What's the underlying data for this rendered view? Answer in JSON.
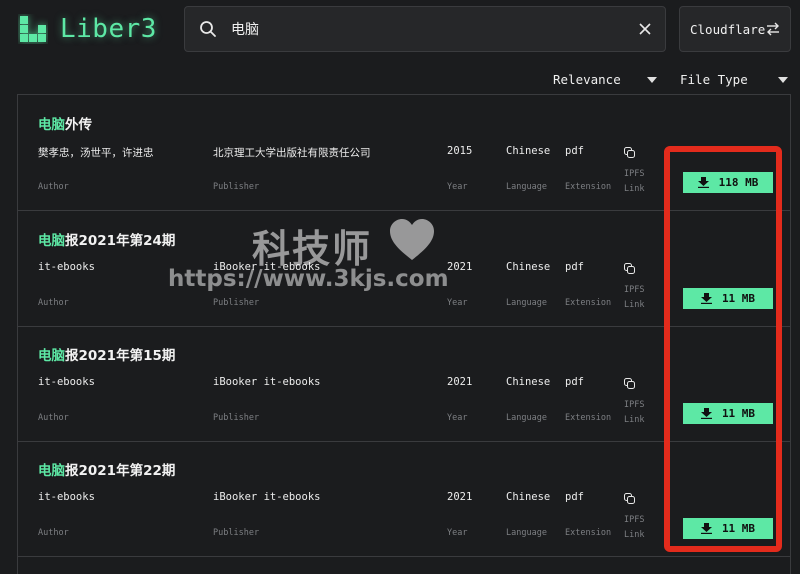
{
  "app": {
    "name": "Liber3"
  },
  "search": {
    "value": "电脑",
    "placeholder": ""
  },
  "gateway": {
    "label": "Cloudflare"
  },
  "sort": {
    "relevance": "Relevance",
    "file_type": "File Type"
  },
  "labels": {
    "author": "Author",
    "publisher": "Publisher",
    "year": "Year",
    "language": "Language",
    "extension": "Extension",
    "ipfs_line1": "IPFS",
    "ipfs_line2": "Link"
  },
  "results": [
    {
      "title_highlight": "电脑",
      "title_rest": "外传",
      "author": "樊孝忠，汤世平，许进忠",
      "publisher": "北京理工大学出版社有限责任公司",
      "year": "2015",
      "language": "Chinese",
      "extension": "pdf",
      "size": "118 MB"
    },
    {
      "title_highlight": "电脑",
      "title_rest": "报2021年第24期",
      "author": "it-ebooks",
      "publisher": "iBooker it-ebooks",
      "year": "2021",
      "language": "Chinese",
      "extension": "pdf",
      "size": "11 MB"
    },
    {
      "title_highlight": "电脑",
      "title_rest": "报2021年第15期",
      "author": "it-ebooks",
      "publisher": "iBooker it-ebooks",
      "year": "2021",
      "language": "Chinese",
      "extension": "pdf",
      "size": "11 MB"
    },
    {
      "title_highlight": "电脑",
      "title_rest": "报2021年第22期",
      "author": "it-ebooks",
      "publisher": "iBooker it-ebooks",
      "year": "2021",
      "language": "Chinese",
      "extension": "pdf",
      "size": "11 MB"
    }
  ],
  "watermark": {
    "line1": "科技师",
    "line2": "https://www.3kjs.com"
  },
  "colors": {
    "accent": "#5de8a5",
    "background": "#1b1c1e",
    "highlight_frame": "#e32b1c"
  }
}
